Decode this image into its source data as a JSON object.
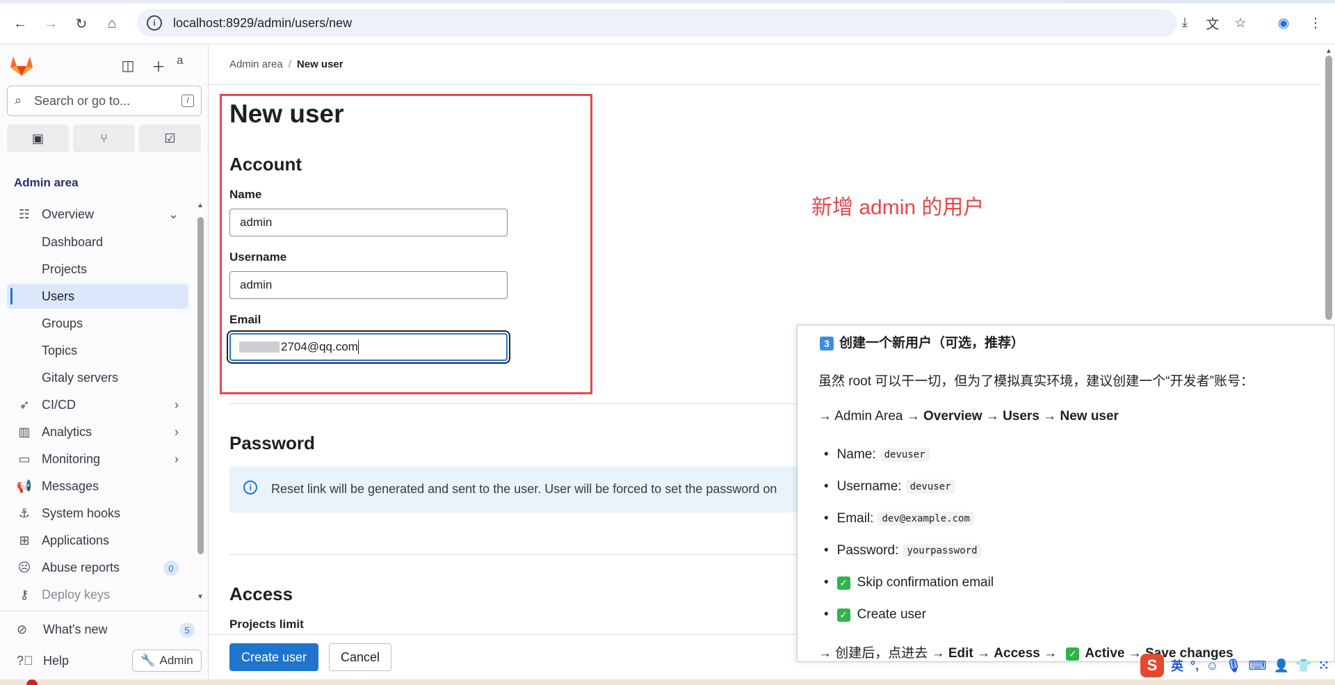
{
  "browser": {
    "url": "localhost:8929/admin/users/new",
    "icons": [
      "back-icon",
      "forward-icon",
      "reload-icon",
      "home-icon",
      "site-info-icon",
      "install-icon",
      "translate-icon",
      "bookmark-star-icon",
      "profile-icon",
      "menu-icon"
    ]
  },
  "sidebar": {
    "search_placeholder": "Search or go to...",
    "search_shortcut": "/",
    "avatar_alt": "a",
    "section_title": "Admin area",
    "items": [
      {
        "label": "Overview",
        "icon": "overview-icon",
        "chevron": "⌄"
      },
      {
        "label": "Dashboard"
      },
      {
        "label": "Projects"
      },
      {
        "label": "Users",
        "active": true
      },
      {
        "label": "Groups"
      },
      {
        "label": "Topics"
      },
      {
        "label": "Gitaly servers"
      },
      {
        "label": "CI/CD",
        "icon": "rocket-icon",
        "chevron": "›"
      },
      {
        "label": "Analytics",
        "icon": "chart-icon",
        "chevron": "›"
      },
      {
        "label": "Monitoring",
        "icon": "monitor-icon",
        "chevron": "›"
      },
      {
        "label": "Messages",
        "icon": "megaphone-icon"
      },
      {
        "label": "System hooks",
        "icon": "anchor-icon"
      },
      {
        "label": "Applications",
        "icon": "applications-icon"
      },
      {
        "label": "Abuse reports",
        "icon": "abuse-icon",
        "badge": "0"
      },
      {
        "label": "Deploy keys",
        "icon": "key-icon"
      }
    ],
    "whats_new": {
      "label": "What's new",
      "badge": "5"
    },
    "help": "Help",
    "admin_button": "Admin"
  },
  "main": {
    "breadcrumb": {
      "parent": "Admin area",
      "separator": "/",
      "current": "New user"
    },
    "title": "New user",
    "account": {
      "heading": "Account",
      "name_label": "Name",
      "name_value": "admin",
      "username_label": "Username",
      "username_value": "admin",
      "email_label": "Email",
      "email_value": "2704@qq.com"
    },
    "annotation": "新增 admin 的用户",
    "password": {
      "heading": "Password",
      "alert": "Reset link will be generated and sent to the user. User will be forced to set the password on"
    },
    "access": {
      "heading": "Access",
      "projects_limit_label": "Projects limit"
    },
    "buttons": {
      "create": "Create user",
      "cancel": "Cancel"
    }
  },
  "doc": {
    "step_number": "3",
    "heading": "创建一个新用户（可选，推荐）",
    "intro": "虽然 root 可以干一切，但为了模拟真实环境，建议创建一个“开发者”账号：",
    "path": {
      "prefix": "→ Admin Area → ",
      "overview": "Overview",
      "arrow1": " → ",
      "users": "Users",
      "arrow2": " → ",
      "new_user": "New user"
    },
    "fields": [
      {
        "label": "Name:",
        "value": "devuser"
      },
      {
        "label": "Username:",
        "value": "devuser"
      },
      {
        "label": "Email:",
        "value": "dev@example.com"
      },
      {
        "label": "Password:",
        "value": "yourpassword"
      }
    ],
    "checks": [
      "Skip confirmation email",
      "Create user"
    ],
    "after": {
      "prefix": "→ 创建后，点进去 → ",
      "edit": "Edit",
      "arrow1": " → ",
      "access": "Access",
      "arrow2": " → ",
      "active": "Active",
      "arrow3": " → ",
      "save": "Save changes"
    }
  },
  "ime": {
    "lang": "英"
  },
  "colors": {
    "accent": "#1f75cb",
    "annotation_red": "#e5474b",
    "active_nav": "#dbe7fa"
  }
}
